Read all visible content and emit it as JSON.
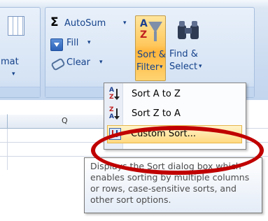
{
  "ribbon": {
    "cells_group": {
      "format_partial": "mat"
    },
    "editing_group": {
      "autosum_label": "AutoSum",
      "fill_label": "Fill",
      "clear_label": "Clear",
      "sort_filter_line1": "Sort &",
      "sort_filter_line2": "Filter",
      "find_select_line1": "Find &",
      "find_select_line2": "Select"
    },
    "icons": {
      "sigma": "Σ",
      "dropdown": "▾"
    }
  },
  "grid": {
    "column_header": "Q"
  },
  "menu": {
    "items": [
      {
        "label": "Sort A to Z",
        "icon": "sort-a-to-z-icon"
      },
      {
        "label": "Sort Z to A",
        "icon": "sort-z-to-a-icon"
      },
      {
        "label": "Custom Sort...",
        "icon": "custom-sort-icon"
      }
    ]
  },
  "tooltip": {
    "text": "Displays the Sort dialog box which enables sorting by multiple columns or rows, case-sensitive sorts, and other sort options."
  },
  "colors": {
    "highlight": "#ffd980",
    "annotation_red": "#c00000",
    "ribbon_text": "#15428b"
  }
}
